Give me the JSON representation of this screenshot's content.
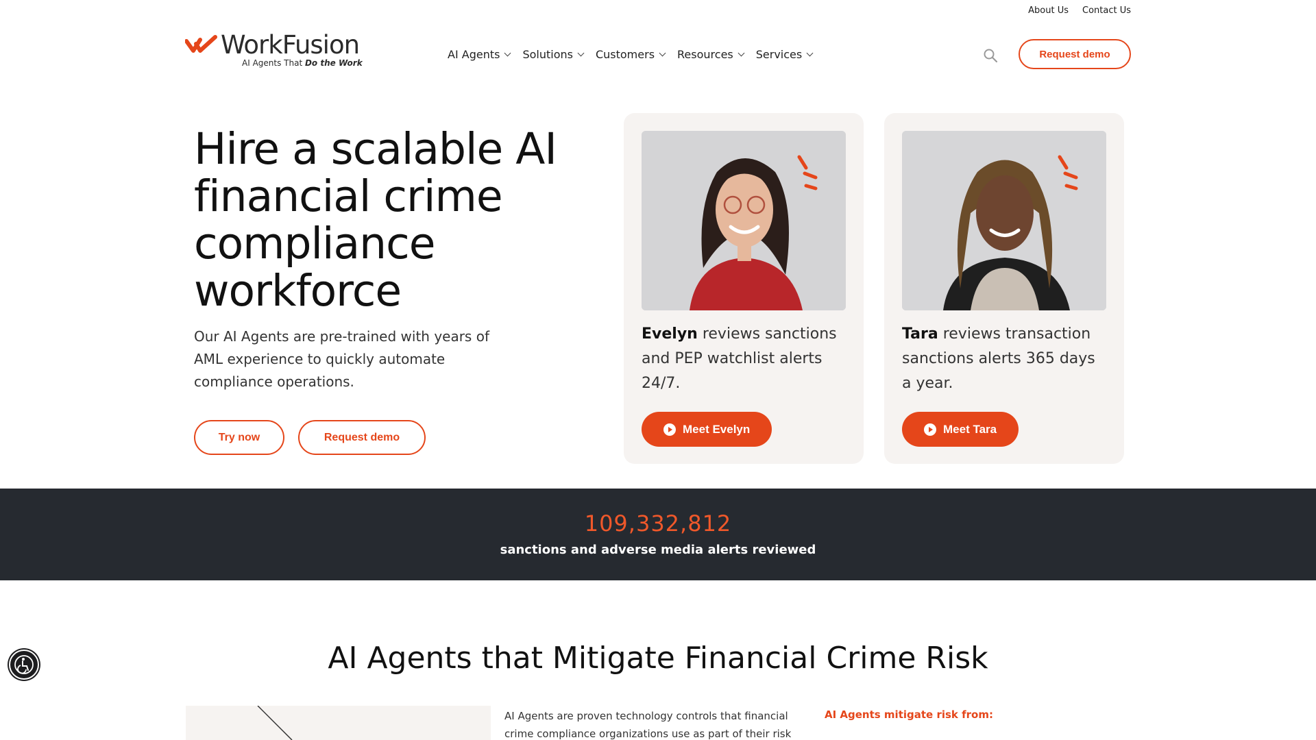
{
  "utility_nav": {
    "about": "About Us",
    "contact": "Contact Us"
  },
  "logo": {
    "wordmark": "WorkFusion",
    "tagline_prefix": "AI Agents That ",
    "tagline_emphasis": "Do the Work"
  },
  "nav": {
    "items": [
      {
        "label": "AI Agents"
      },
      {
        "label": "Solutions"
      },
      {
        "label": "Customers"
      },
      {
        "label": "Resources"
      },
      {
        "label": "Services"
      }
    ],
    "request_demo": "Request demo"
  },
  "hero": {
    "title": "Hire a scalable AI financial crime compliance workforce",
    "subtitle": "Our AI Agents are pre-trained with years of AML experience to quickly automate compliance operations.",
    "try_now": "Try now",
    "request_demo": "Request demo"
  },
  "agents": [
    {
      "name": "Evelyn",
      "description": " reviews sanctions and PEP watchlist alerts 24/7.",
      "button": "Meet Evelyn"
    },
    {
      "name": "Tara",
      "description": " reviews transaction sanctions alerts 365 days a year.",
      "button": "Meet Tara"
    }
  ],
  "stats": {
    "number": "109,332,812",
    "label": "sanctions and adverse media alerts reviewed"
  },
  "section": {
    "title": "AI Agents that Mitigate Financial Crime Risk",
    "text": "AI Agents are proven technology controls that financial crime compliance organizations use as part of their risk",
    "risk_heading": "AI Agents mitigate risk from:"
  },
  "colors": {
    "accent": "#e5461a",
    "dark_band": "#262a30",
    "card_bg": "#f6f3f1"
  },
  "icons": {
    "search": "search-icon",
    "play": "play-icon",
    "accessibility": "accessibility-icon"
  }
}
